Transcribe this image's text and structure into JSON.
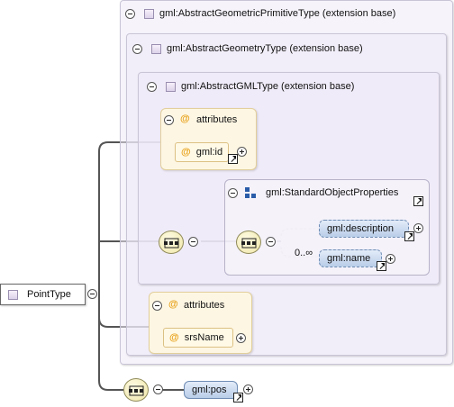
{
  "diagram": {
    "root": {
      "label": "PointType"
    },
    "containers": {
      "primitive": {
        "label": "gml:AbstractGeometricPrimitiveType (extension base)"
      },
      "geometry": {
        "label": "gml:AbstractGeometryType (extension base)"
      },
      "gml": {
        "label": "gml:AbstractGMLType (extension base)"
      }
    },
    "gml_attributes": {
      "title": "attributes",
      "at_symbol": "@",
      "items": [
        "gml:id"
      ]
    },
    "standard_properties": {
      "label": "gml:StandardObjectProperties",
      "icon": "group-icon"
    },
    "occurrence": "0..∞",
    "elements": [
      "gml:description",
      "gml:name"
    ],
    "geometry_attributes": {
      "title": "attributes",
      "at_symbol": "@",
      "items": [
        "srsName"
      ]
    },
    "pos_element": {
      "label": "gml:pos"
    }
  }
}
